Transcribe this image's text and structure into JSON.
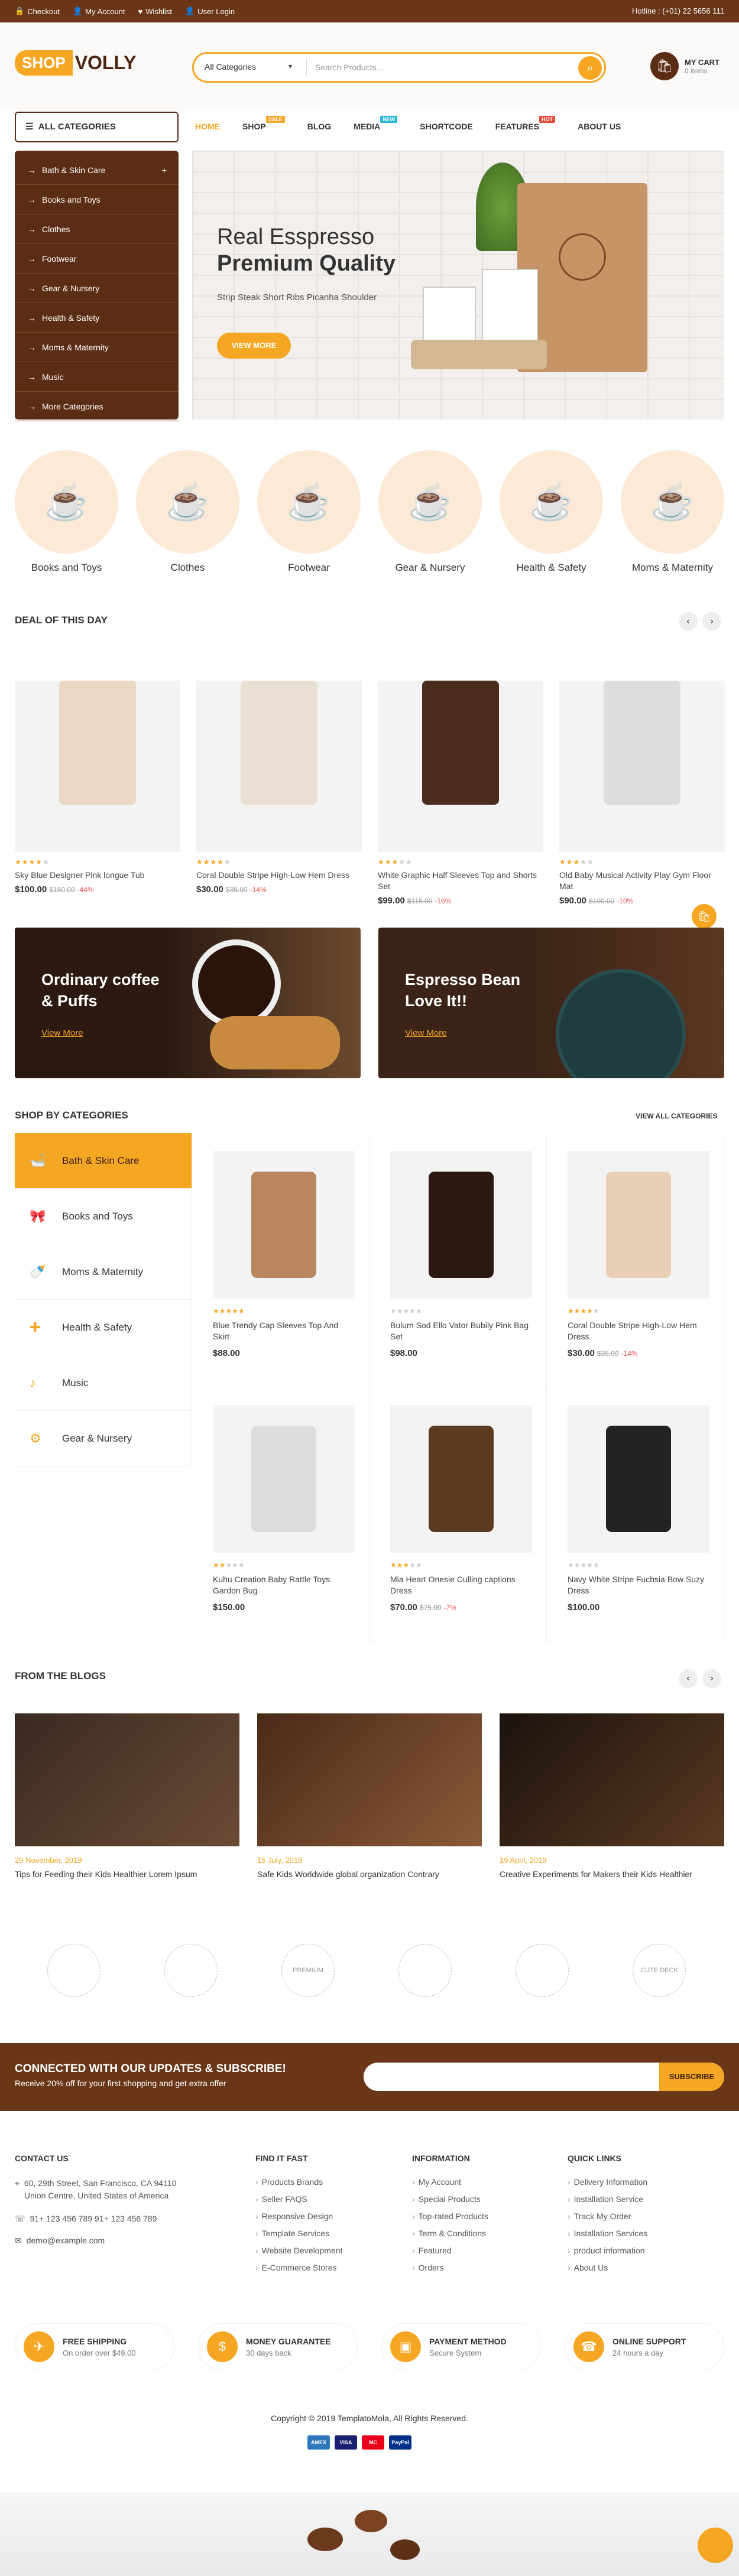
{
  "topbar": {
    "checkout": "Checkout",
    "account": "My Account",
    "wishlist": "Wishlist",
    "login": "User Login",
    "hotline": "Hotline : (+01) 22 5656 111"
  },
  "header": {
    "logo_shop": "SHOP",
    "logo_volly": "VOLLY",
    "category_select": "All Categories",
    "search_placeholder": "Search Products...",
    "cart_title": "MY CART",
    "cart_items": "0 items"
  },
  "nav": {
    "all_categories": "ALL CATEGORIES",
    "menu": [
      {
        "label": "HOME"
      },
      {
        "label": "SHOP",
        "badge": "SALE"
      },
      {
        "label": "BLOG"
      },
      {
        "label": "MEDIA",
        "badge": "NEW"
      },
      {
        "label": "SHORTCODE"
      },
      {
        "label": "FEATURES",
        "badge": "HOT"
      },
      {
        "label": "ABOUT US"
      }
    ],
    "badge_colors": {
      "SALE": "#f5a623",
      "NEW": "#29b6d8",
      "HOT": "#e74c3c"
    }
  },
  "sidebar": [
    "Bath & Skin Care",
    "Books and Toys",
    "Clothes",
    "Footwear",
    "Gear & Nursery",
    "Health & Safety",
    "Moms & Maternity",
    "Music",
    "More Categories"
  ],
  "hero": {
    "line1": "Real Esspresso",
    "line2": "Premium Quality",
    "line3": "Strip Steak Short Ribs Picanha Shoulder",
    "button": "VIEW MORE"
  },
  "categories": [
    "Books and Toys",
    "Clothes",
    "Footwear",
    "Gear & Nursery",
    "Health & Safety",
    "Moms & Maternity"
  ],
  "deal": {
    "title": "DEAL OF THIS DAY",
    "products": [
      {
        "name": "Sky Blue Designer Pink longue Tub",
        "price": "$100.00",
        "old": "$180.00",
        "disc": "-44%",
        "rating": 4
      },
      {
        "name": "Coral Double Stripe High-Low Hem Dress",
        "price": "$30.00",
        "old": "$35.00",
        "disc": "-14%",
        "rating": 4
      },
      {
        "name": "White Graphic Half Sleeves Top and Shorts Set",
        "price": "$99.00",
        "old": "$118.00",
        "disc": "-16%",
        "rating": 3
      },
      {
        "name": "Old Baby Musical Activity Play Gym Floor Mat",
        "price": "$90.00",
        "old": "$100.00",
        "disc": "-10%",
        "rating": 3
      }
    ]
  },
  "banners": [
    {
      "title": "Ordinary coffee & Puffs",
      "link": "View More"
    },
    {
      "title": "Espresso Bean Love It!!",
      "link": "View More"
    }
  ],
  "shop_by": {
    "title": "SHOP BY CATEGORIES",
    "view_all": "VIEW ALL CATEGORIES",
    "categories": [
      "Bath & Skin Care",
      "Books and Toys",
      "Moms & Maternity",
      "Health & Safety",
      "Music",
      "Gear & Nursery"
    ],
    "products": [
      {
        "name": "Blue Trendy Cap Sleeves Top And Skirt",
        "price": "$88.00",
        "old": "",
        "disc": "",
        "rating": 5
      },
      {
        "name": "Bulum Sod Ello Vator Bubily Pink Bag Set",
        "price": "$98.00",
        "old": "",
        "disc": "",
        "rating": 0
      },
      {
        "name": "Coral Double Stripe High-Low Hem Dress",
        "price": "$30.00",
        "old": "$35.00",
        "disc": "-14%",
        "rating": 4
      },
      {
        "name": "Kuhu Creation Baby Rattle Toys Gardon Bug",
        "price": "$150.00",
        "old": "",
        "disc": "",
        "rating": 2
      },
      {
        "name": "Mia Heart Onesie Culling captions Dress",
        "price": "$70.00",
        "old": "$75.00",
        "disc": "-7%",
        "rating": 3
      },
      {
        "name": "Navy White Stripe Fuchsia Bow Suzy Dress",
        "price": "$100.00",
        "old": "",
        "disc": "",
        "rating": 0
      }
    ]
  },
  "blogs": {
    "title": "FROM THE BLOGS",
    "posts": [
      {
        "date": "29 November, 2019",
        "title": "Tips for Feeding their Kids Healthier Lorem Ipsum"
      },
      {
        "date": "15 July, 2019",
        "title": "Safe Kids Worldwide global organization Contrary"
      },
      {
        "date": "19 April, 2019",
        "title": "Creative Experiments for Makers their Kids Healthier"
      }
    ]
  },
  "brands": [
    "",
    "",
    "PREMIUM",
    "",
    "",
    "CUTE DECK"
  ],
  "newsletter": {
    "title": "CONNECTED WITH OUR UPDATES & SUBSCRIBE!",
    "sub": "Receive 20% off for your first shopping and get extra offer",
    "button": "SUBSCRIBE"
  },
  "footer": {
    "contact": {
      "title": "CONTACT US",
      "address": "60, 29th Street, San Francisco, CA 94110 Union Centre, United States of America",
      "phone": "91+ 123 456 789    91+ 123 456 789",
      "email": "demo@example.com"
    },
    "find": {
      "title": "FIND IT FAST",
      "items": [
        "Products Brands",
        "Seller FAQS",
        "Responsive Design",
        "Template Services",
        "Website Development",
        "E-Commerce Stores"
      ]
    },
    "info": {
      "title": "INFORMATION",
      "items": [
        "My Account",
        "Special Products",
        "Top-rated Products",
        "Term & Conditions",
        "Featured",
        "Orders"
      ]
    },
    "quick": {
      "title": "QUICK LINKS",
      "items": [
        "Delivery Information",
        "Installation Service",
        "Track My Order",
        "Installation Services",
        "product information",
        "About Us"
      ]
    }
  },
  "features": [
    {
      "title": "FREE SHIPPING",
      "sub": "On order over $49.00"
    },
    {
      "title": "MONEY GUARANTEE",
      "sub": "30 days back"
    },
    {
      "title": "PAYMENT METHOD",
      "sub": "Secure System"
    },
    {
      "title": "ONLINE SUPPORT",
      "sub": "24 hours a day"
    }
  ],
  "copyright": "Copyright © 2019 TemplatoMola, All Rights Reserved.",
  "payments": [
    "AMEX",
    "VISA",
    "MC",
    "PayPal"
  ]
}
